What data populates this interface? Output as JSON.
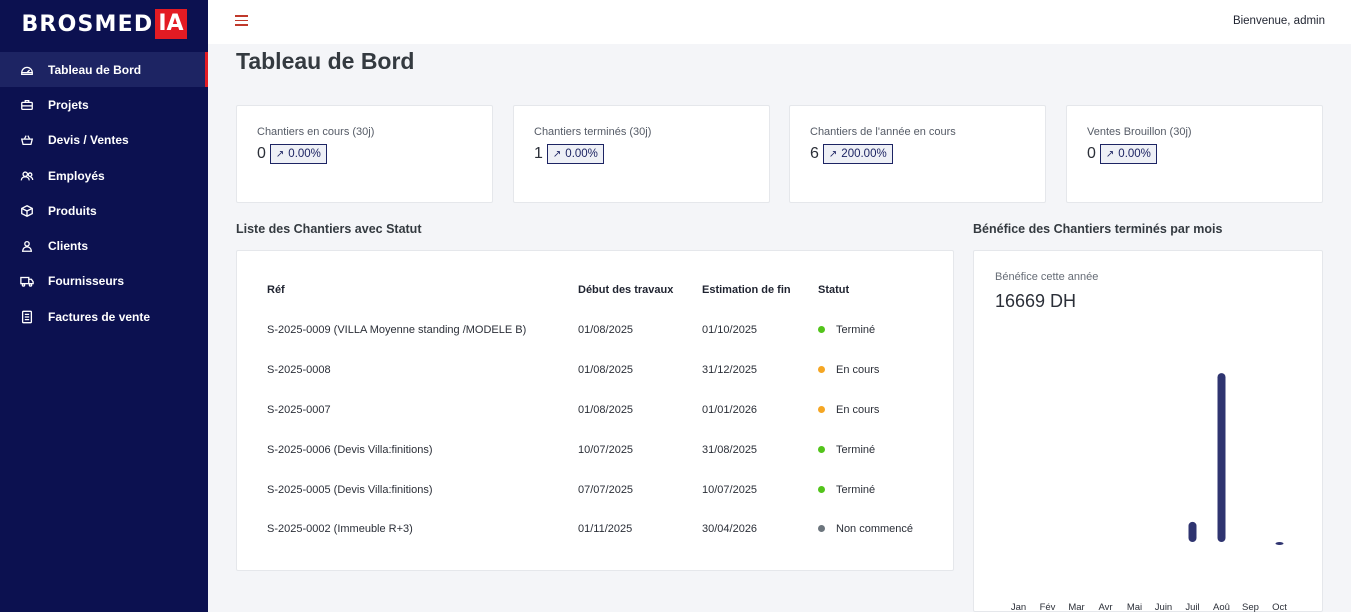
{
  "brand": {
    "name": "BROSMED",
    "badge": "IA"
  },
  "topbar": {
    "welcome": "Bienvenue, admin"
  },
  "sidebar": {
    "items": [
      {
        "label": "Tableau de Bord",
        "icon": "dashboard-icon",
        "active": true
      },
      {
        "label": "Projets",
        "icon": "briefcase-icon"
      },
      {
        "label": "Devis / Ventes",
        "icon": "basket-icon"
      },
      {
        "label": "Employés",
        "icon": "users-icon"
      },
      {
        "label": "Produits",
        "icon": "box-icon"
      },
      {
        "label": "Clients",
        "icon": "user-icon"
      },
      {
        "label": "Fournisseurs",
        "icon": "truck-icon"
      },
      {
        "label": "Factures de vente",
        "icon": "invoice-icon"
      }
    ]
  },
  "page": {
    "title": "Tableau de Bord"
  },
  "stats": [
    {
      "label": "Chantiers en cours (30j)",
      "value": "0",
      "change": "0.00%"
    },
    {
      "label": "Chantiers terminés (30j)",
      "value": "1",
      "change": "0.00%"
    },
    {
      "label": "Chantiers de l'année en cours",
      "value": "6",
      "change": "200.00%"
    },
    {
      "label": "Ventes Brouillon (30j)",
      "value": "0",
      "change": "0.00%"
    }
  ],
  "table": {
    "title": "Liste des Chantiers avec Statut",
    "headers": [
      "Réf",
      "Début des travaux",
      "Estimation de fin",
      "Statut"
    ],
    "rows": [
      {
        "ref": "S-2025-0009 (VILLA Moyenne standing /MODELE B)",
        "start": "01/08/2025",
        "end": "01/10/2025",
        "status": "Terminé",
        "color": "#52c41a"
      },
      {
        "ref": "S-2025-0008",
        "start": "01/08/2025",
        "end": "31/12/2025",
        "status": "En cours",
        "color": "#f5a623"
      },
      {
        "ref": "S-2025-0007",
        "start": "01/08/2025",
        "end": "01/01/2026",
        "status": "En cours",
        "color": "#f5a623"
      },
      {
        "ref": "S-2025-0006 (Devis Villa:finitions)",
        "start": "10/07/2025",
        "end": "31/08/2025",
        "status": "Terminé",
        "color": "#52c41a"
      },
      {
        "ref": "S-2025-0005 (Devis Villa:finitions)",
        "start": "07/07/2025",
        "end": "10/07/2025",
        "status": "Terminé",
        "color": "#52c41a"
      },
      {
        "ref": "S-2025-0002 (Immeuble R+3)",
        "start": "01/11/2025",
        "end": "30/04/2026",
        "status": "Non commencé",
        "color": "#6c757d"
      }
    ]
  },
  "chart": {
    "title": "Bénéfice des Chantiers terminés par mois",
    "subtitle": "Bénéfice cette année",
    "total": "16669 DH"
  },
  "chart_data": {
    "type": "bar",
    "categories": [
      "Jan",
      "Fév",
      "Mar",
      "Avr",
      "Mai",
      "Juin",
      "Juil",
      "Aoû",
      "Sep",
      "Oct"
    ],
    "values": [
      0,
      0,
      0,
      0,
      0,
      0,
      1800,
      15100,
      0,
      -230
    ],
    "bar_color": "#2f3470",
    "ylim": [
      -500,
      16000
    ],
    "grid": false
  }
}
